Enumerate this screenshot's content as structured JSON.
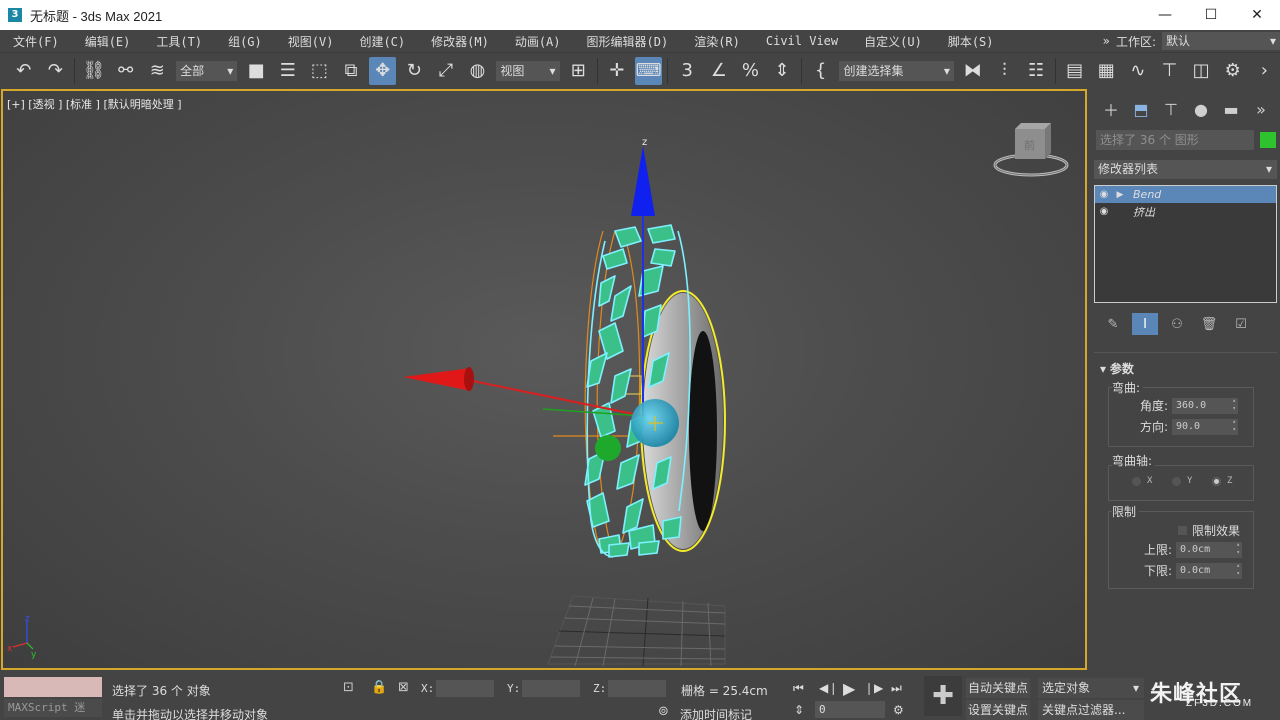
{
  "window": {
    "app_icon": "3",
    "title": "无标题 - 3ds Max 2021",
    "minimize": "—",
    "maximize": "☐",
    "close": "✕"
  },
  "menu": {
    "items": [
      "文件(F)",
      "编辑(E)",
      "工具(T)",
      "组(G)",
      "视图(V)",
      "创建(C)",
      "修改器(M)",
      "动画(A)",
      "图形编辑器(D)",
      "渲染(R)",
      "Civil View",
      "自定义(U)",
      "脚本(S)"
    ],
    "more": "»",
    "workspace_label": "工作区:",
    "workspace_value": "默认"
  },
  "toolbar": {
    "selection_filter": "全部",
    "reference_coord": "视图",
    "named_selection": "创建选择集"
  },
  "viewport": {
    "label": "[+] [透视 ] [标准 ] [默认明暗处理 ]",
    "gizmo_z": "z",
    "axis_z": "z",
    "axis_x": "x",
    "axis_y": "y",
    "viewcube_face": "前"
  },
  "command_panel": {
    "selection_name": "选择了 36 个 图形",
    "modifier_list": "修改器列表",
    "stack": [
      {
        "name": "Bend",
        "selected": true
      },
      {
        "name": "挤出",
        "selected": false
      }
    ],
    "rollout_title": "参数",
    "bend_group": "弯曲:",
    "angle_label": "角度:",
    "angle_value": "360.0",
    "direction_label": "方向:",
    "direction_value": "90.0",
    "axis_group": "弯曲轴:",
    "axes": [
      "X",
      "Y",
      "Z"
    ],
    "selected_axis": "Z",
    "limits_group": "限制",
    "limit_effect": "限制效果",
    "upper_label": "上限:",
    "upper_value": "0.0cm",
    "lower_label": "下限:",
    "lower_value": "0.0cm"
  },
  "status": {
    "maxscript": "MAXScript 迷",
    "selected_objects": "选择了 36 个 对象",
    "prompt": "单击并拖动以选择并移动对象",
    "x_label": "X:",
    "y_label": "Y:",
    "z_label": "Z:",
    "grid": "栅格 = 25.4cm",
    "add_time_tag": "添加时间标记",
    "frame": "0",
    "auto_key": "自动关键点",
    "set_key": "设置关键点",
    "key_mode": "选定对象",
    "key_filters": "关键点过滤器..."
  },
  "watermark": {
    "main": "朱峰社区",
    "sub": "ZF3D.COM"
  },
  "colors": {
    "accent": "#5a86b8",
    "viewport_border": "#d6a82a",
    "object_color": "#2ec32e"
  }
}
